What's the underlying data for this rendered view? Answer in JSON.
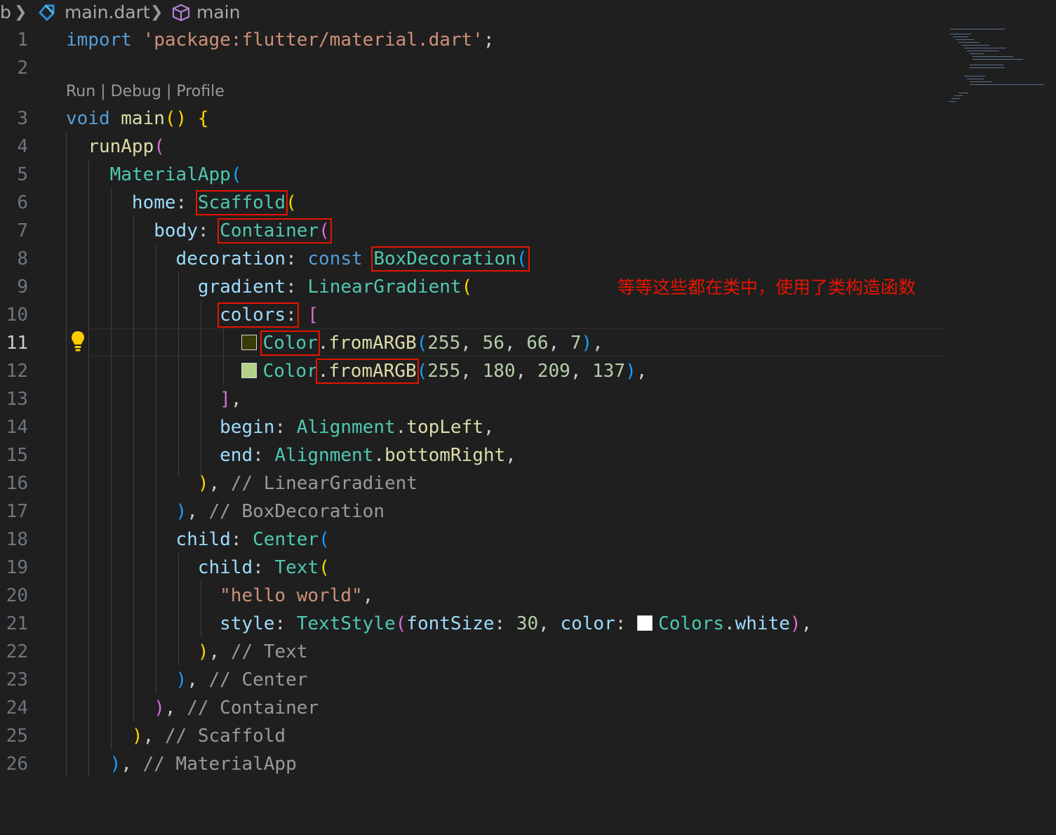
{
  "breadcrumb": {
    "root_fragment": "b",
    "file_name": "main.dart",
    "symbol_name": "main"
  },
  "code_lens": {
    "run": "Run",
    "sep1": " | ",
    "debug": "Debug",
    "sep2": " | ",
    "profile": "Profile"
  },
  "annotation": "等等这些都在类中，使用了类构造函数",
  "active_line": 11,
  "line_numbers": [
    "1",
    "2",
    "3",
    "4",
    "5",
    "6",
    "7",
    "8",
    "9",
    "10",
    "11",
    "12",
    "13",
    "14",
    "15",
    "16",
    "17",
    "18",
    "19",
    "20",
    "21",
    "22",
    "23",
    "24",
    "25",
    "26"
  ],
  "code": {
    "l1": {
      "import": "import",
      "path": "'package:flutter/material.dart'",
      "semi": ";"
    },
    "l3": {
      "void": "void",
      "main": "main",
      "parens": "()",
      "brace": "{"
    },
    "l4": {
      "fn": "runApp",
      "paren": "("
    },
    "l5": {
      "cls": "MaterialApp",
      "paren": "("
    },
    "l6": {
      "prop": "home",
      "colon": ":",
      "cls": "Scaffold",
      "paren": "("
    },
    "l7": {
      "prop": "body",
      "colon": ":",
      "cls": "Container",
      "paren": "("
    },
    "l8": {
      "prop": "decoration",
      "colon": ":",
      "kw": "const",
      "cls": "BoxDecoration",
      "paren": "("
    },
    "l9": {
      "prop": "gradient",
      "colon": ":",
      "cls": "LinearGradient",
      "paren": "("
    },
    "l10": {
      "prop": "colors",
      "colon": ":",
      "bracket": "["
    },
    "l11": {
      "cls": "Color",
      "dot": ".",
      "fn": "fromARGB",
      "open": "(",
      "a": "255",
      "c1": ", ",
      "r": "56",
      "c2": ", ",
      "g": "66",
      "c3": ", ",
      "b": "7",
      "close": ")",
      "comma": ",",
      "swatch": "#383a07"
    },
    "l12": {
      "cls": "Color",
      "dot": ".",
      "fn": "fromARGB",
      "open": "(",
      "a": "255",
      "c1": ", ",
      "r": "180",
      "c2": ", ",
      "g": "209",
      "c3": ", ",
      "b": "137",
      "close": ")",
      "comma": ",",
      "swatch": "#b4d189"
    },
    "l13": {
      "bracket": "]",
      "comma": ","
    },
    "l14": {
      "prop": "begin",
      "colon": ":",
      "cls": "Alignment",
      "dot": ".",
      "value": "topLeft",
      "comma": ","
    },
    "l15": {
      "prop": "end",
      "colon": ":",
      "cls": "Alignment",
      "dot": ".",
      "value": "bottomRight",
      "comma": ","
    },
    "l16": {
      "paren": ")",
      "comma": ",",
      "comment": "// LinearGradient"
    },
    "l17": {
      "paren": ")",
      "comma": ",",
      "comment": "// BoxDecoration"
    },
    "l18": {
      "prop": "child",
      "colon": ":",
      "cls": "Center",
      "paren": "("
    },
    "l19": {
      "prop": "child",
      "colon": ":",
      "cls": "Text",
      "paren": "("
    },
    "l20": {
      "str": "\"hello world\"",
      "comma": ","
    },
    "l21": {
      "prop": "style",
      "colon": ":",
      "cls": "TextStyle",
      "open": "(",
      "p1": "fontSize",
      "c1": ":",
      "num": "30",
      "sep": ", ",
      "p2": "color",
      "c2": ":",
      "swatch": "#ffffff",
      "cls2": "Colors",
      "dot": ".",
      "value": "white",
      "close": ")",
      "comma": ","
    },
    "l22": {
      "paren": ")",
      "comma": ",",
      "comment": "// Text"
    },
    "l23": {
      "paren": ")",
      "comma": ",",
      "comment": "// Center"
    },
    "l24": {
      "paren": ")",
      "comma": ",",
      "comment": "// Container"
    },
    "l25": {
      "paren": ")",
      "comma": ",",
      "comment": "// Scaffold"
    },
    "l26": {
      "paren": ")",
      "comma": ",",
      "comment": "// MaterialApp"
    }
  }
}
